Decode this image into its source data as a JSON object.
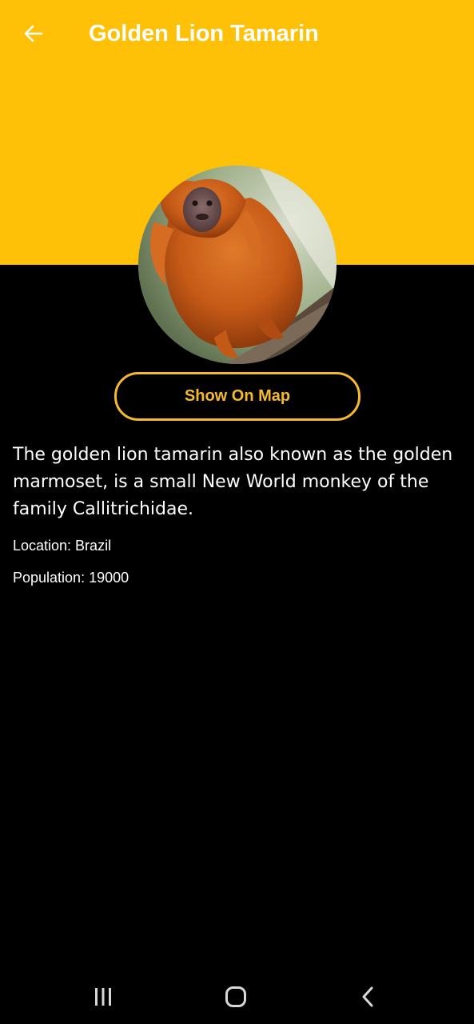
{
  "header": {
    "title": "Golden Lion Tamarin",
    "back_icon": "arrow-left-icon",
    "background_color": "#FFC107"
  },
  "profile_image": {
    "subject": "golden lion tamarin"
  },
  "actions": {
    "show_on_map_label": "Show On Map",
    "accent_color": "#F6B92C"
  },
  "details": {
    "description": "The golden lion tamarin also known as the golden marmoset, is a small New World monkey of the family Callitrichidae.",
    "location": "Location: Brazil",
    "population": "Population: 19000"
  },
  "system_nav": {
    "recents_icon": "recents-icon",
    "home_icon": "home-icon",
    "back_icon": "back-chevron-icon"
  }
}
